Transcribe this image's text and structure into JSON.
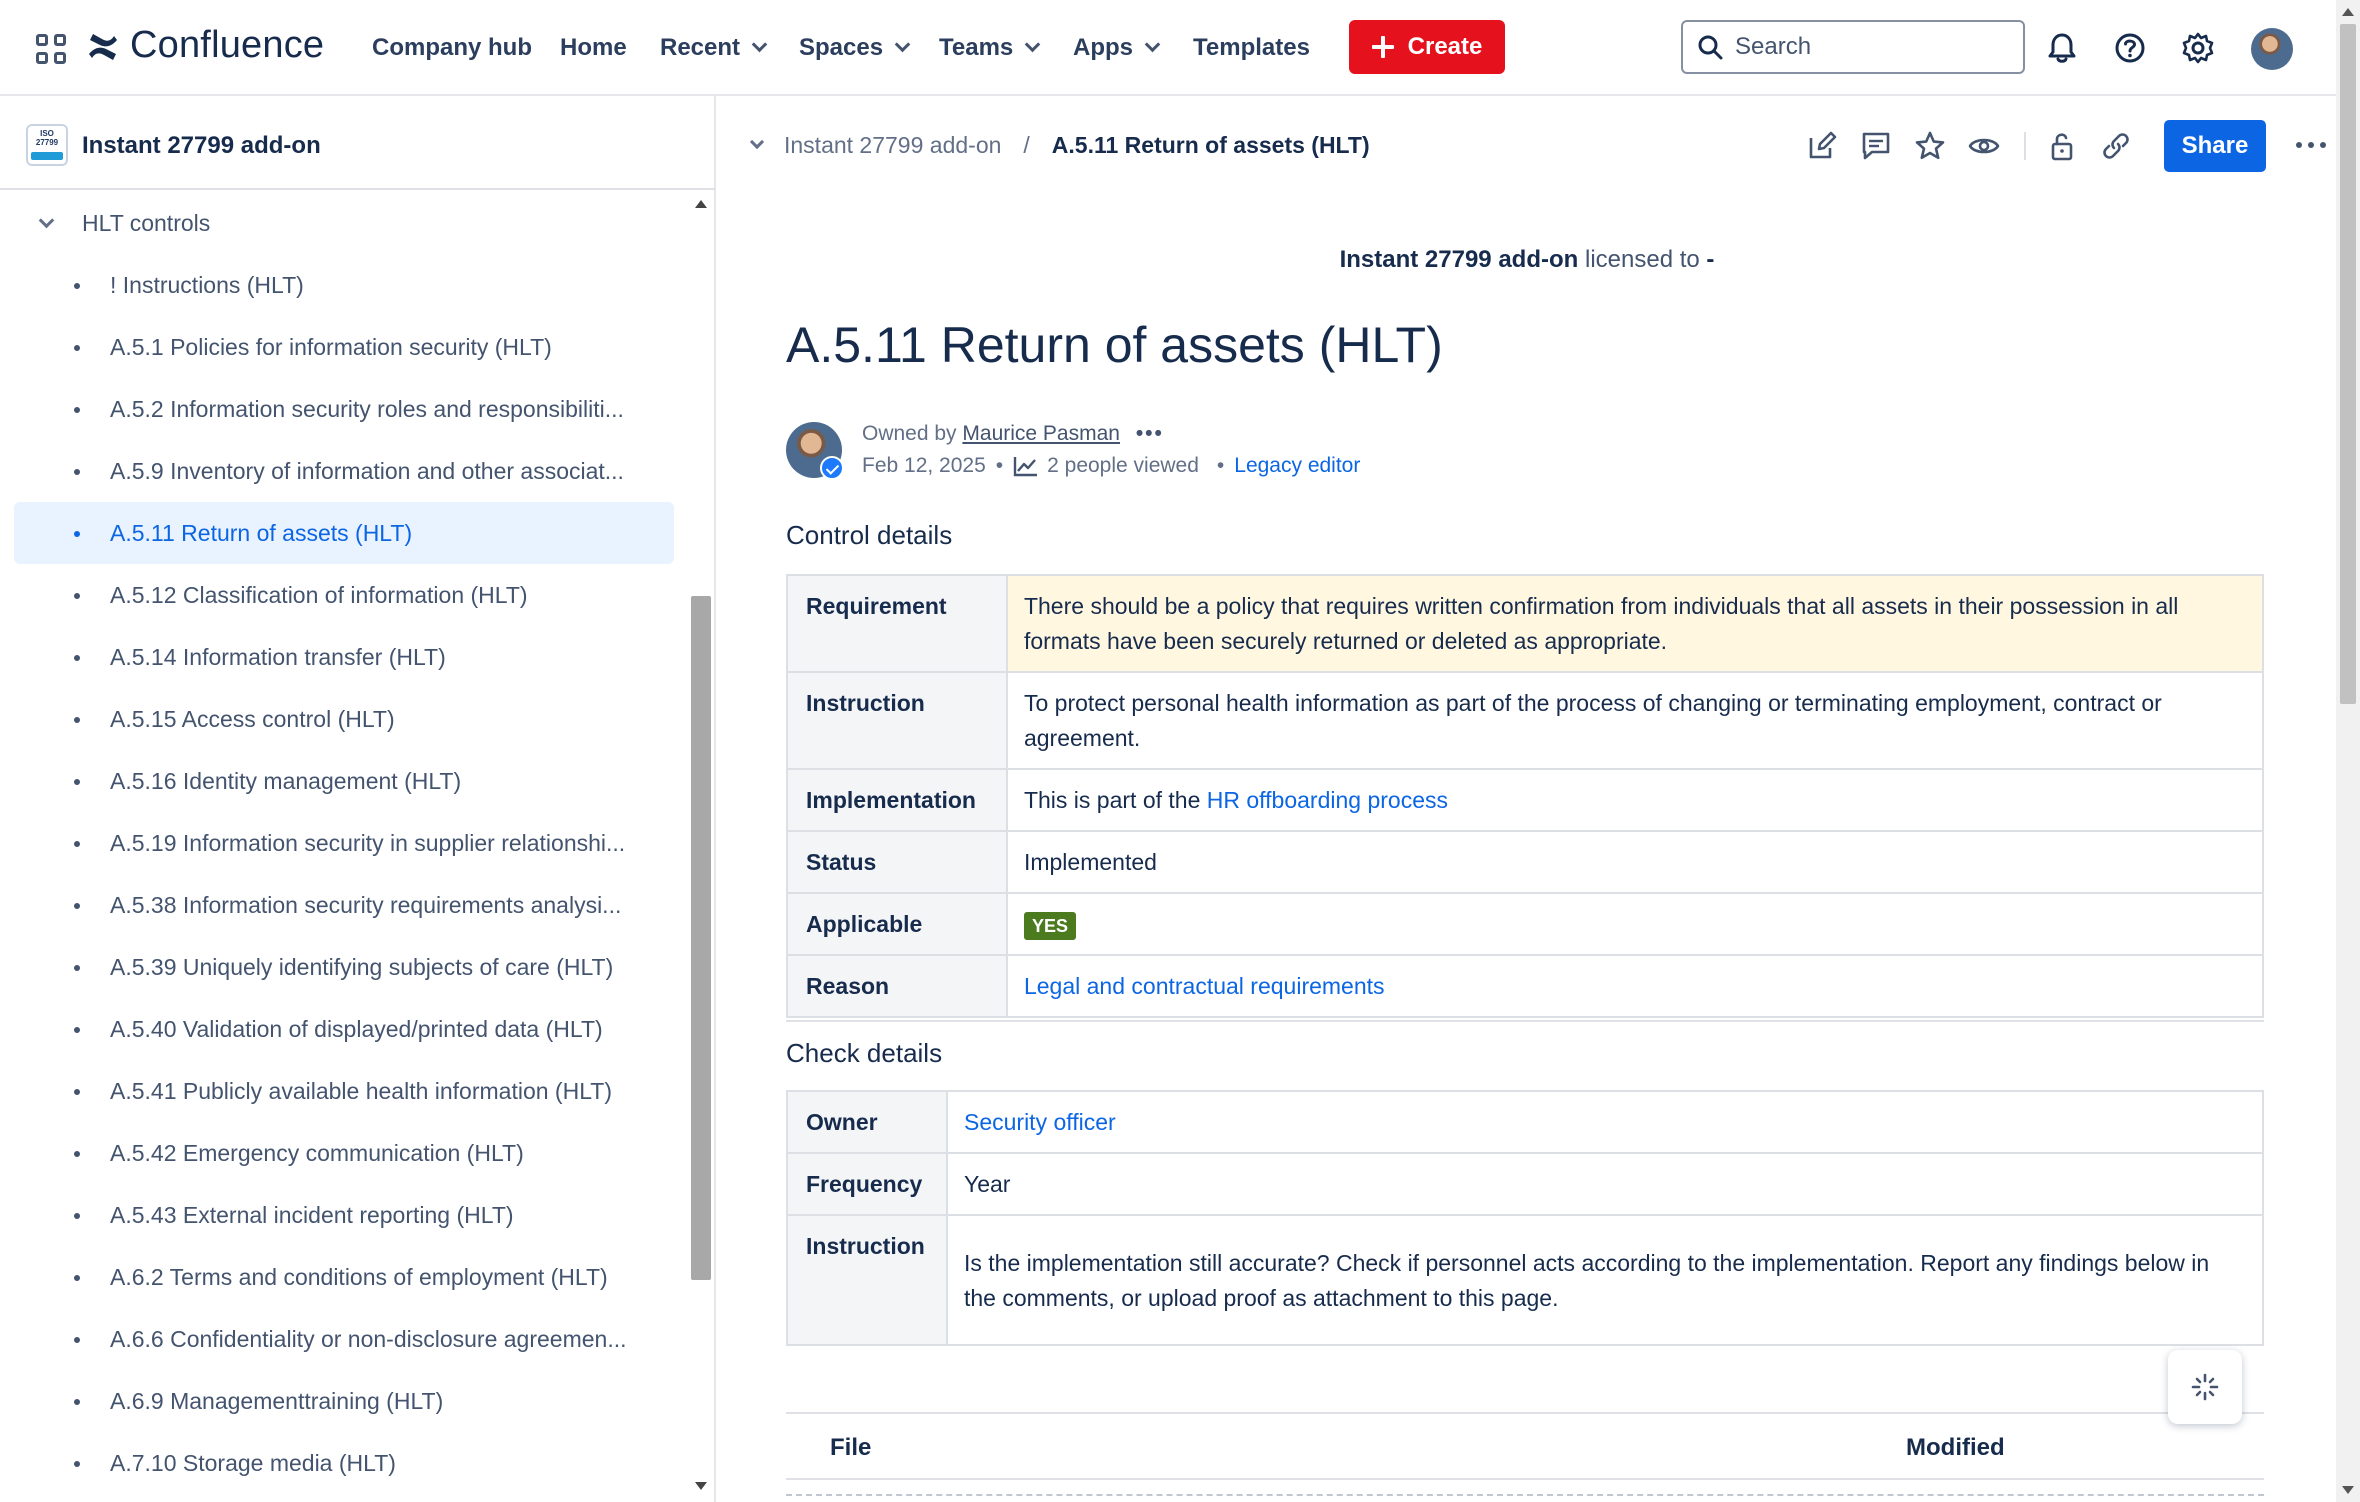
{
  "topnav": {
    "logo": "Confluence",
    "items": [
      {
        "label": "Company hub",
        "has_menu": false
      },
      {
        "label": "Home",
        "has_menu": false
      },
      {
        "label": "Recent",
        "has_menu": true
      },
      {
        "label": "Spaces",
        "has_menu": true
      },
      {
        "label": "Teams",
        "has_menu": true
      },
      {
        "label": "Apps",
        "has_menu": true
      },
      {
        "label": "Templates",
        "has_menu": false
      }
    ],
    "create_label": "Create",
    "search_placeholder": "Search",
    "create_color": "#e5121e"
  },
  "sidebar": {
    "space_name": "Instant 27799 add-on",
    "space_icon_text": "ISO 27799",
    "parent": "HLT controls",
    "items": [
      "! Instructions (HLT)",
      "A.5.1 Policies for information security (HLT)",
      "A.5.2 Information security roles and responsibiliti...",
      "A.5.9 Inventory of information and other associat...",
      "A.5.11 Return of assets (HLT)",
      "A.5.12 Classification of information (HLT)",
      "A.5.14 Information transfer (HLT)",
      "A.5.15 Access control (HLT)",
      "A.5.16 Identity management (HLT)",
      "A.5.19 Information security in supplier relationshi...",
      "A.5.38 Information security requirements analysi...",
      "A.5.39 Uniquely identifying subjects of care (HLT)",
      "A.5.40 Validation of displayed/printed data (HLT)",
      "A.5.41 Publicly available health information (HLT)",
      "A.5.42 Emergency communication (HLT)",
      "A.5.43 External incident reporting (HLT)",
      "A.6.2 Terms and conditions of employment (HLT)",
      "A.6.6 Confidentiality or non-disclosure agreemen...",
      "A.6.9 Managementtraining (HLT)",
      "A.7.10 Storage media (HLT)"
    ],
    "selected_index": 4
  },
  "breadcrumb": {
    "space": "Instant 27799 add-on",
    "separator": "/",
    "current": "A.5.11 Return of assets (HLT)"
  },
  "toolbar": {
    "share_label": "Share",
    "share_color": "#0c66e4"
  },
  "license": {
    "product": "Instant 27799 add-on",
    "text": "licensed to",
    "value": "-"
  },
  "page": {
    "title": "A.5.11 Return of assets (HLT)",
    "owned_by_prefix": "Owned by",
    "owner": "Maurice Pasman",
    "date": "Feb 12, 2025",
    "views": "2 people viewed",
    "editor": "Legacy editor"
  },
  "control": {
    "heading": "Control details",
    "requirement_label": "Requirement",
    "requirement": "There should be a policy that requires written confirmation from individuals that all assets in their possession in all formats have been securely returned or deleted as appropriate.",
    "instruction_label": "Instruction",
    "instruction": "To protect personal health information as part of the process of changing or terminating employment, contract or agreement.",
    "implementation_label": "Implementation",
    "implementation_prefix": "This is part of the",
    "implementation_link": "HR offboarding process",
    "status_label": "Status",
    "status": "Implemented",
    "applicable_label": "Applicable",
    "applicable": "YES",
    "applicable_color": "#4c7a1e",
    "reason_label": "Reason",
    "reason": "Legal and contractual requirements"
  },
  "check": {
    "heading": "Check details",
    "owner_label": "Owner",
    "owner": "Security officer",
    "frequency_label": "Frequency",
    "frequency": "Year",
    "instruction_label": "Instruction",
    "instruction": "Is the implementation still accurate? Check if personnel acts according to the implementation. Report any findings below in the comments, or upload proof as attachment to this page."
  },
  "files": {
    "col_file": "File",
    "col_modified": "Modified"
  },
  "icons": {
    "app_switcher": "grid-icon",
    "logo": "confluence-logo-icon",
    "search": "search-icon",
    "notifications": "bell-icon",
    "help": "help-icon",
    "settings": "gear-icon",
    "edit": "edit-icon",
    "comment": "comment-icon",
    "star": "star-icon",
    "watch": "eye-icon",
    "restrictions": "unlock-icon",
    "copy_link": "link-icon",
    "more": "more-icon",
    "ai": "sparkle-icon"
  }
}
